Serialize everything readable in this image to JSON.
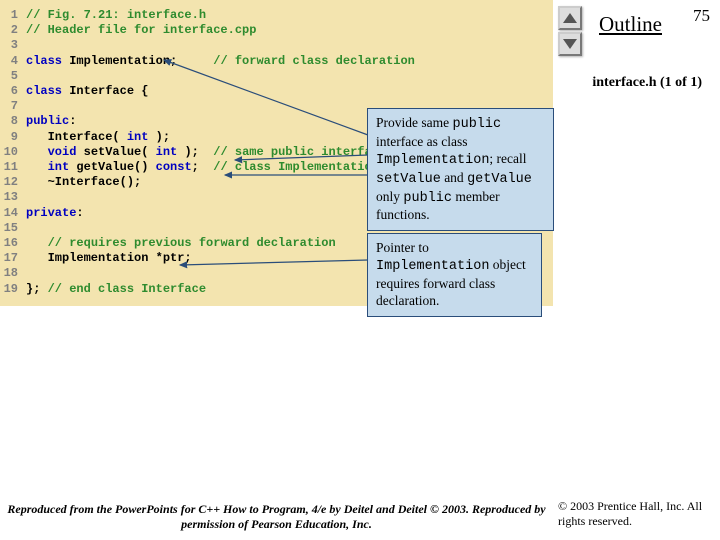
{
  "slide": {
    "number": "75",
    "outline": "Outline",
    "subtitle": "interface.h (1 of 1)"
  },
  "code": {
    "gutters": [
      "1",
      "2",
      "3",
      "4",
      "5",
      "6",
      "7",
      "8",
      "9",
      "10",
      "11",
      "12",
      "13",
      "14",
      "15",
      "16",
      "17",
      "18",
      "19"
    ],
    "l1": "// Fig. 7.21: interface.h",
    "l2": "// Header file for interface.cpp",
    "l4_kw": "class ",
    "l4_id": "Implementation;     ",
    "l4_cmt": "// forward class declaration",
    "l6_kw": "class ",
    "l6_id": "Interface {",
    "l8_kw": "public",
    "l8_id": ":",
    "l9": "   Interface( ",
    "l9_kw": "int",
    "l9b": " );",
    "l10a": "   ",
    "l10_kw1": "void",
    "l10b": " setValue( ",
    "l10_kw2": "int",
    "l10c": " );  ",
    "l10_cmt": "// same public interface as",
    "l11a": "   ",
    "l11_kw1": "int",
    "l11b": " getValue() ",
    "l11_kw2": "const",
    "l11c": ";  ",
    "l11_cmt": "// class Implementation",
    "l12": "   ~Interface();",
    "l14_kw": "private",
    "l14_id": ":",
    "l16": "   ",
    "l16_cmt": "// requires previous forward declaration",
    "l17": "   Implementation *ptr;",
    "l19a": "}; ",
    "l19_cmt": "// end class Interface"
  },
  "callout1": {
    "t1": "Provide same ",
    "m1": "public",
    "t2": " interface as class ",
    "m2": "Implementation",
    "t3": "; recall ",
    "m3": "setValue",
    "t4": " and ",
    "m4": "getValue",
    "t5": " only ",
    "m5": "public",
    "t6": " member functions."
  },
  "callout2": {
    "t1": "Pointer to ",
    "m1": "Implementation",
    "t2": " object requires forward class declaration."
  },
  "footer": {
    "copyright": "© 2003 Prentice Hall, Inc. All rights reserved.",
    "reproduced": "Reproduced from the PowerPoints for C++ How to Program, 4/e by Deitel and Deitel © 2003. Reproduced by permission of Pearson Education, Inc."
  }
}
